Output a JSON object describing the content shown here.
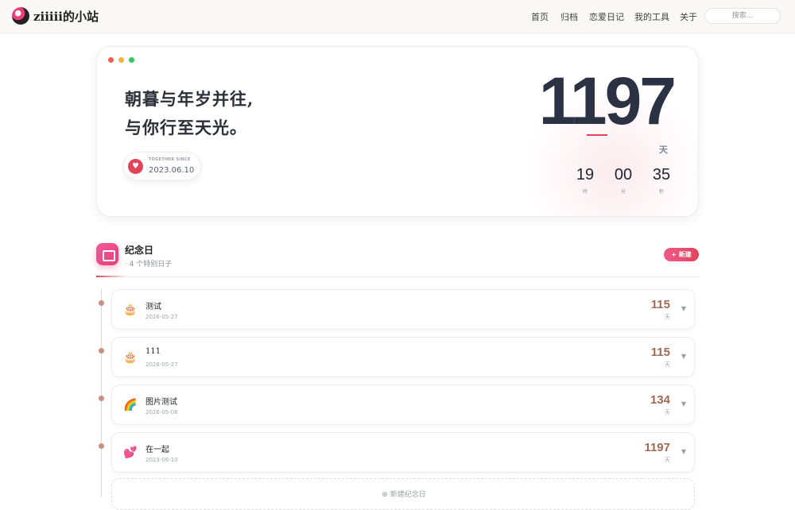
{
  "header": {
    "brand": "ziiiii的小站",
    "nav": [
      "首页",
      "归档",
      "恋爱日记",
      "我的工具",
      "关于"
    ],
    "search_placeholder": "搜索..."
  },
  "hero": {
    "slogan_line1": "朝暮与年岁并往,",
    "slogan_line2": "与你行至天光。",
    "since_label": "TOGETHER SINCE",
    "since_date": "2023.06.10",
    "days": "1197",
    "days_unit": "天",
    "hours": "19",
    "hours_label": "时",
    "minutes": "00",
    "minutes_label": "分",
    "seconds": "35",
    "seconds_label": "秒"
  },
  "section": {
    "title": "纪念日",
    "subtitle": "· 4 个特别日子",
    "new_button": "新建",
    "new_button_icon": "+"
  },
  "anniversaries": [
    {
      "icon": "cake-icon",
      "emoji": "🎂",
      "title": "测试",
      "date": "2026-05-27",
      "days": "115",
      "unit": "天"
    },
    {
      "icon": "cake-icon",
      "emoji": "🎂",
      "title": "111",
      "date": "2026-05-27",
      "days": "115",
      "unit": "天"
    },
    {
      "icon": "rainbow-icon",
      "emoji": "🌈",
      "title": "图片测试",
      "date": "2026-05-08",
      "days": "134",
      "unit": "天"
    },
    {
      "icon": "hearts-icon",
      "emoji": "💕",
      "title": "在一起",
      "date": "2023-06-10",
      "days": "1197",
      "unit": "天"
    }
  ],
  "add_row_label": "新建纪念日",
  "add_row_icon": "⊕",
  "colors": {
    "accent": "#e2435a",
    "days_color": "#a06a56",
    "dark": "#2b3243"
  }
}
